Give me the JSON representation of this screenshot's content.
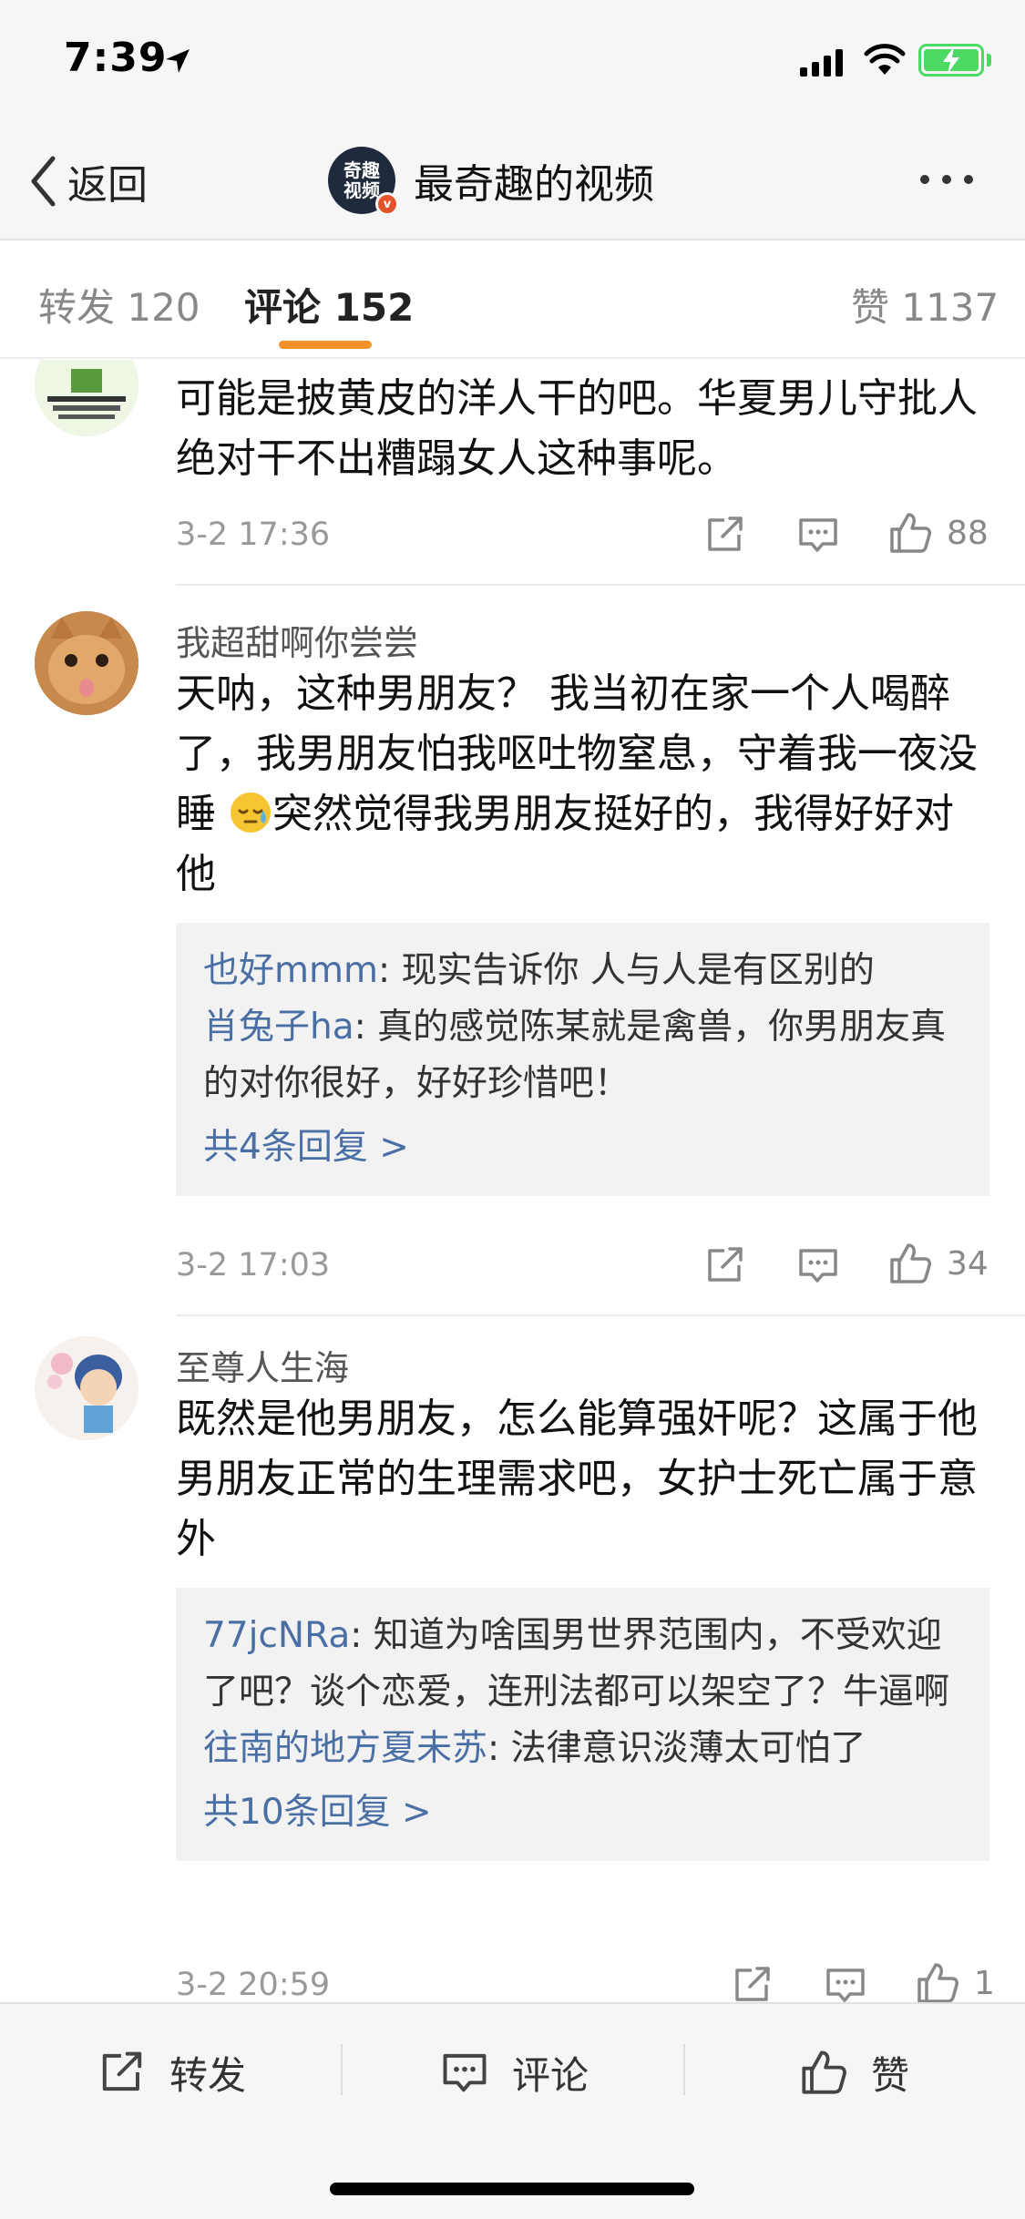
{
  "status_bar": {
    "time": "7:39"
  },
  "nav": {
    "back_label": "返回",
    "title": "最奇趣的视频",
    "avatar_text": "奇趣视频"
  },
  "tabs": [
    {
      "label": "转发 120"
    },
    {
      "label": "评论 152"
    },
    {
      "label": "赞 1137"
    }
  ],
  "comments": [
    {
      "body": "可能是披黄皮的洋人干的吧。华夏男儿守批人绝对干不出糟蹋女人这种事呢。",
      "time": "3-2 17:36",
      "likes": "88"
    },
    {
      "username": "我超甜啊你尝尝",
      "body_before": "天呐，这种男朋友？ 我当初在家一个人喝醉了，我男朋友怕我呕吐物窒息，守着我一夜没睡 ",
      "body_after": "突然觉得我男朋友挺好的，我得好好对他",
      "replies": [
        {
          "user": "也好mmm",
          "text": ": 现实告诉你 人与人是有区别的"
        },
        {
          "user": "肖兔子ha",
          "text": ": 真的感觉陈某就是禽兽，你男朋友真的对你很好，好好珍惜吧！"
        }
      ],
      "reply_total": "共4条回复 >",
      "time": "3-2 17:03",
      "likes": "34"
    },
    {
      "username": "至尊人生海",
      "body": "既然是他男朋友，怎么能算强奸呢？这属于他男朋友正常的生理需求吧，女护士死亡属于意外",
      "replies": [
        {
          "user": "77jcNRa",
          "text": ": 知道为啥国男世界范围内，不受欢迎了吧？谈个恋爱，连刑法都可以架空了？牛逼啊"
        },
        {
          "user": "往南的地方夏未苏",
          "text": ": 法律意识淡薄太可怕了"
        }
      ],
      "reply_total": "共10条回复 >",
      "time": "3-2 20:59",
      "likes": "1"
    }
  ],
  "bottom_bar": {
    "repost": "转发",
    "comment": "评论",
    "like": "赞"
  }
}
